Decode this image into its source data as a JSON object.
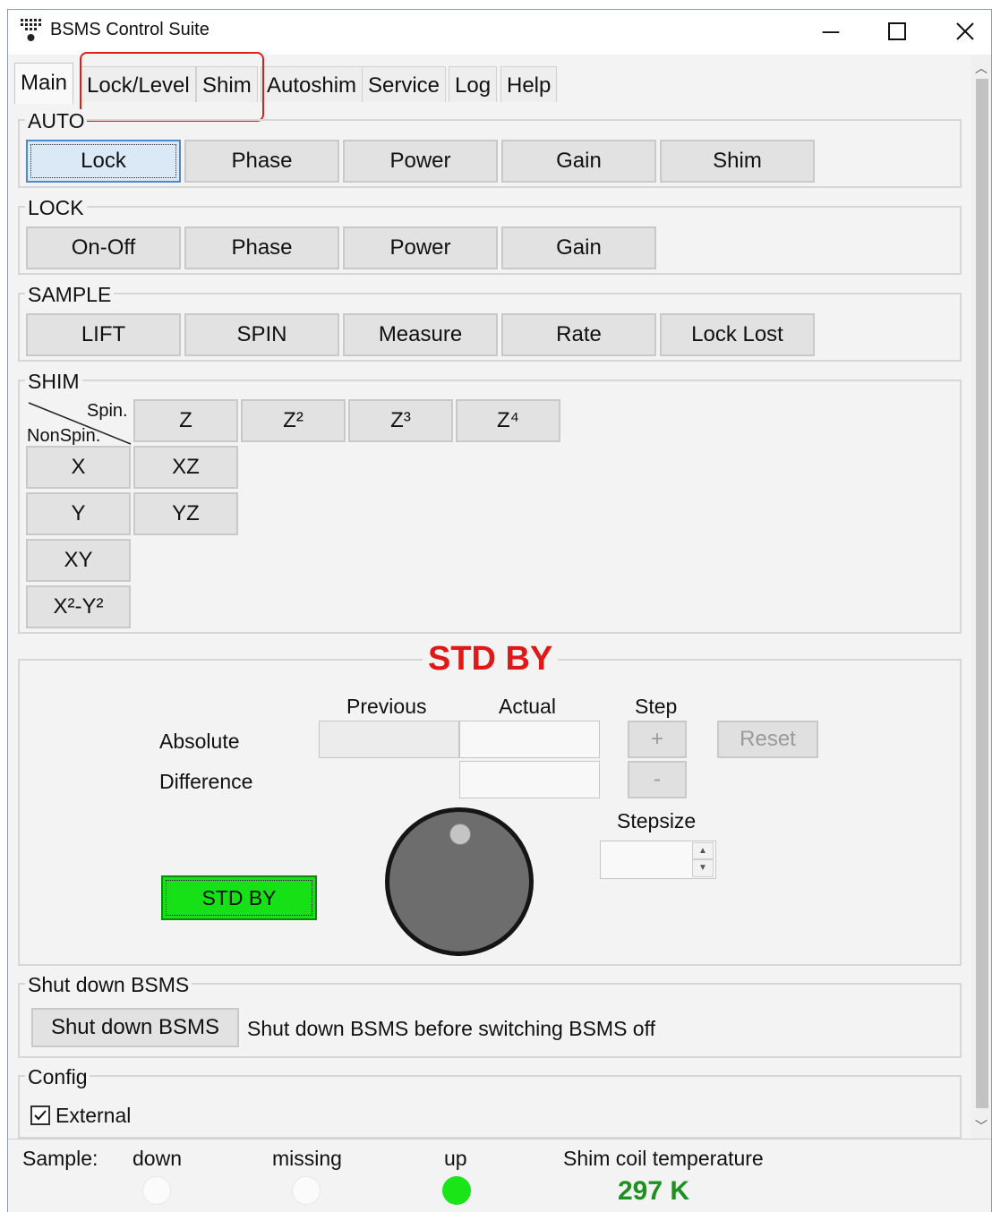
{
  "window": {
    "title": "BSMS Control Suite",
    "icon": "keypad-icon"
  },
  "tabs": [
    "Main",
    "Lock/Level",
    "Shim",
    "Autoshim",
    "Service",
    "Log",
    "Help"
  ],
  "auto": {
    "title": "AUTO",
    "buttons": [
      "Lock",
      "Phase",
      "Power",
      "Gain",
      "Shim"
    ]
  },
  "lock": {
    "title": "LOCK",
    "buttons": [
      "On-Off",
      "Phase",
      "Power",
      "Gain"
    ]
  },
  "sample": {
    "title": "SAMPLE",
    "buttons": [
      "LIFT",
      "SPIN",
      "Measure",
      "Rate",
      "Lock Lost"
    ]
  },
  "shim": {
    "title": "SHIM",
    "spin_label": "Spin.",
    "nonspin_label": "NonSpin.",
    "spin_buttons": [
      "Z",
      "Z²",
      "Z³",
      "Z⁴"
    ],
    "nonspin_buttons": [
      "X",
      "Y",
      "XY",
      "X²-Y²"
    ],
    "extra_buttons": [
      "XZ",
      "YZ"
    ]
  },
  "control": {
    "title": "STD BY",
    "col_previous": "Previous",
    "col_actual": "Actual",
    "col_step": "Step",
    "row_absolute": "Absolute",
    "row_difference": "Difference",
    "plus": "+",
    "minus": "-",
    "reset": "Reset",
    "stepsize": "Stepsize",
    "std_by_button": "STD BY",
    "colors": {
      "title": "#e01818",
      "std_by_button": "#16e016"
    }
  },
  "shutdown": {
    "title": "Shut down BSMS",
    "button": "Shut down BSMS",
    "note": "Shut down BSMS before switching BSMS off"
  },
  "config": {
    "title": "Config",
    "external_label": "External",
    "external_checked": true
  },
  "status": {
    "sample_label": "Sample:",
    "down": "down",
    "missing": "missing",
    "up": "up",
    "temp_label": "Shim coil temperature",
    "temp_value": "297 K",
    "colors": {
      "up_led": "#19e519",
      "temp": "#1f8f1f"
    }
  }
}
